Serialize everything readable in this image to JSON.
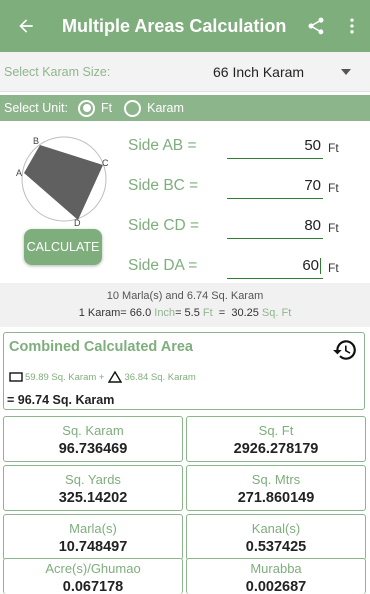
{
  "appbar": {
    "title": "Multiple Areas Calculation",
    "back_icon": "arrow-left",
    "share_icon": "share",
    "menu_icon": "more-vert"
  },
  "karam_size": {
    "label": "Select Karam Size:",
    "value": "66 Inch Karam"
  },
  "unit": {
    "label": "Select Unit:",
    "options": [
      "Ft",
      "Karam"
    ],
    "selected": "Ft"
  },
  "diagram": {
    "labels": [
      "A",
      "B",
      "C",
      "D"
    ]
  },
  "calculate_label": "CALCULATE",
  "sides": [
    {
      "label": "Side AB =",
      "value": "50",
      "unit": "Ft"
    },
    {
      "label": "Side BC =",
      "value": "70",
      "unit": "Ft"
    },
    {
      "label": "Side CD =",
      "value": "80",
      "unit": "Ft"
    },
    {
      "label": "Side DA =",
      "value": "60",
      "unit": "Ft"
    }
  ],
  "info": {
    "line1": "10 Marla(s) and 6.74 Sq. Karam",
    "line2": {
      "prefix": "1 Karam= ",
      "inch_val": "66.0",
      "inch_unit": " Inch",
      "eq1": "= ",
      "ft_val": "5.5",
      "ft_unit": " Ft",
      "eq2": "  =  ",
      "sqft_val": "30.25",
      "sqft_unit": " Sq. Ft"
    }
  },
  "combined": {
    "title": "Combined Calculated Area",
    "rect_part": "59.89 Sq. Karam +",
    "tri_part": "36.84 Sq. Karam",
    "total": "= 96.74 Sq. Karam"
  },
  "results": [
    {
      "label": "Sq. Karam",
      "value": "96.736469"
    },
    {
      "label": "Sq. Ft",
      "value": "2926.278179"
    },
    {
      "label": "Sq. Yards",
      "value": "325.14202"
    },
    {
      "label": "Sq. Mtrs",
      "value": "271.860149"
    },
    {
      "label": "Marla(s)",
      "value": "10.748497"
    },
    {
      "label": "Kanal(s)",
      "value": "0.537425"
    },
    {
      "label": "Acre(s)/Ghumao",
      "value": "0.067178"
    },
    {
      "label": "Murabba",
      "value": "0.002687"
    }
  ],
  "colors": {
    "primary": "#7fae7d",
    "accent": "#8db58b",
    "dark_green": "#2f7d33"
  }
}
